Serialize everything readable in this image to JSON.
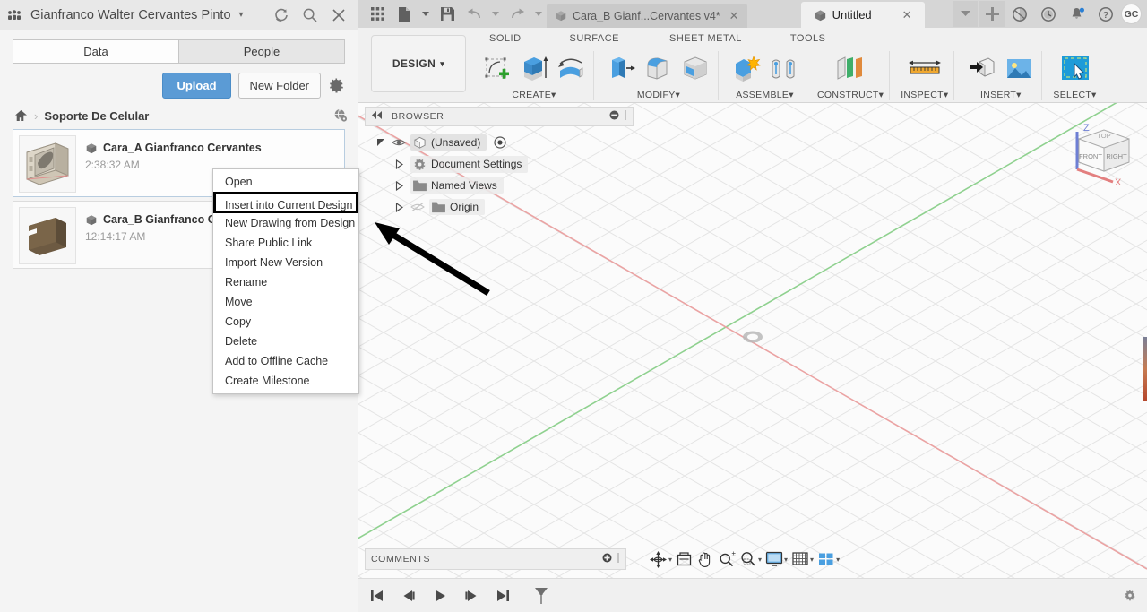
{
  "data_panel": {
    "account_name": "Gianfranco Walter Cervantes Pinto",
    "account_caret": "▾",
    "icons": {
      "people": "people-icon",
      "refresh": "refresh-icon",
      "search": "search-icon",
      "close": "close-icon",
      "gear": "gear-icon",
      "home": "home-icon",
      "globe": "globe-icon"
    },
    "tabs": [
      {
        "label": "Data",
        "active": true
      },
      {
        "label": "People",
        "active": false
      }
    ],
    "buttons": {
      "upload": "Upload",
      "new_folder": "New Folder"
    },
    "breadcrumb": {
      "root_icon": "home-icon",
      "separator": "›",
      "current": "Soporte De Celular"
    },
    "files": [
      {
        "name": "Cara_A Gianfranco Cervantes",
        "time": "2:38:32 AM",
        "selected": true
      },
      {
        "name": "Cara_B Gianfranco C",
        "time": "12:14:17 AM",
        "selected": false
      }
    ]
  },
  "context_menu": {
    "items": [
      {
        "label": "Open",
        "highlighted": false
      },
      {
        "label": "Insert into Current Design",
        "highlighted": true
      },
      {
        "label": "New Drawing from Design",
        "highlighted": false
      },
      {
        "label": "Share Public Link",
        "highlighted": false
      },
      {
        "label": "Import New Version",
        "highlighted": false
      },
      {
        "label": "Rename",
        "highlighted": false
      },
      {
        "label": "Move",
        "highlighted": false
      },
      {
        "label": "Copy",
        "highlighted": false
      },
      {
        "label": "Delete",
        "highlighted": false
      },
      {
        "label": "Add to Offline Cache",
        "highlighted": false
      },
      {
        "label": "Create Milestone",
        "highlighted": false
      }
    ]
  },
  "titlebar": {
    "left_icons": [
      "grid-apps-icon",
      "new-file-icon",
      "save-icon",
      "undo-icon",
      "redo-icon"
    ],
    "tabs": [
      {
        "label": "Cara_B  Gianf...Cervantes v4*",
        "active": false,
        "close": "✕"
      },
      {
        "label": "Untitled",
        "active": true,
        "close": "✕"
      }
    ],
    "right_icons": [
      "chevron-down-icon",
      "plus-icon",
      "job-status-icon",
      "recent-icon",
      "notifications-icon",
      "help-icon"
    ],
    "avatar_initials": "GC"
  },
  "ribbon": {
    "design_label": "DESIGN",
    "design_caret": "▾",
    "workspace_tabs": [
      "SOLID",
      "SURFACE",
      "SHEET METAL",
      "TOOLS"
    ],
    "groups": [
      {
        "label": "CREATE",
        "caret": "▾",
        "icons": [
          "create-sketch-icon",
          "extrude-icon",
          "revolve-icon"
        ]
      },
      {
        "label": "MODIFY",
        "caret": "▾",
        "icons": [
          "press-pull-icon",
          "fillet-icon",
          "shell-icon"
        ]
      },
      {
        "label": "ASSEMBLE",
        "caret": "▾",
        "icons": [
          "new-component-icon",
          "joint-icon"
        ]
      },
      {
        "label": "CONSTRUCT",
        "caret": "▾",
        "icons": [
          "offset-plane-icon"
        ]
      },
      {
        "label": "INSPECT",
        "caret": "▾",
        "icons": [
          "measure-icon"
        ]
      },
      {
        "label": "INSERT",
        "caret": "▾",
        "icons": [
          "insert-derive-icon",
          "insert-image-icon"
        ]
      },
      {
        "label": "SELECT",
        "caret": "▾",
        "icons": [
          "select-window-icon"
        ]
      }
    ]
  },
  "browser": {
    "header": "BROWSER",
    "collapse_icon": "collapse-left-icon",
    "minimize_icon": "minimize-icon",
    "tree": [
      {
        "label": "(Unsaved)",
        "icon": "component-icon",
        "eye": "eye-icon",
        "depth": 0,
        "badge": "target-icon"
      },
      {
        "label": "Document Settings",
        "icon": "gear-icon",
        "depth": 1
      },
      {
        "label": "Named Views",
        "icon": "folder-icon",
        "depth": 1
      },
      {
        "label": "Origin",
        "icon": "folder-icon",
        "depth": 1,
        "eye": "eye-hidden-icon"
      }
    ]
  },
  "viewcube": {
    "faces": [
      "TOP",
      "FRONT",
      "RIGHT"
    ],
    "axes": [
      {
        "label": "Z",
        "color": "#4a6fd4"
      },
      {
        "label": "X",
        "color": "#e06666"
      }
    ]
  },
  "comments": {
    "label": "COMMENTS",
    "add_icon": "add-comment-icon"
  },
  "view_tools": [
    {
      "name": "orbit-icon",
      "has_dropdown": true
    },
    {
      "name": "pan-view-icon",
      "has_dropdown": false
    },
    {
      "name": "pan-hand-icon",
      "has_dropdown": false
    },
    {
      "name": "zoom-icon",
      "has_dropdown": false
    },
    {
      "name": "zoom-window-icon",
      "has_dropdown": true
    },
    {
      "name": "display-settings-icon",
      "has_dropdown": true
    },
    {
      "name": "grid-snaps-icon",
      "has_dropdown": true
    },
    {
      "name": "viewports-icon",
      "has_dropdown": true
    }
  ],
  "timeline": {
    "buttons": [
      "go-to-beginning-icon",
      "step-back-icon",
      "play-icon",
      "step-forward-icon",
      "go-to-end-icon",
      "filter-icon"
    ],
    "settings_icon": "gear-icon"
  },
  "colors": {
    "accent_blue": "#5b9bd5",
    "panel_bg": "#f4f4f4",
    "ribbon_bg": "#f0f0f0",
    "viewport_bg": "#fbfbfb",
    "axis_red": "#e8a0a0",
    "axis_green": "#9ad79a",
    "highlight_border": "#000000"
  }
}
